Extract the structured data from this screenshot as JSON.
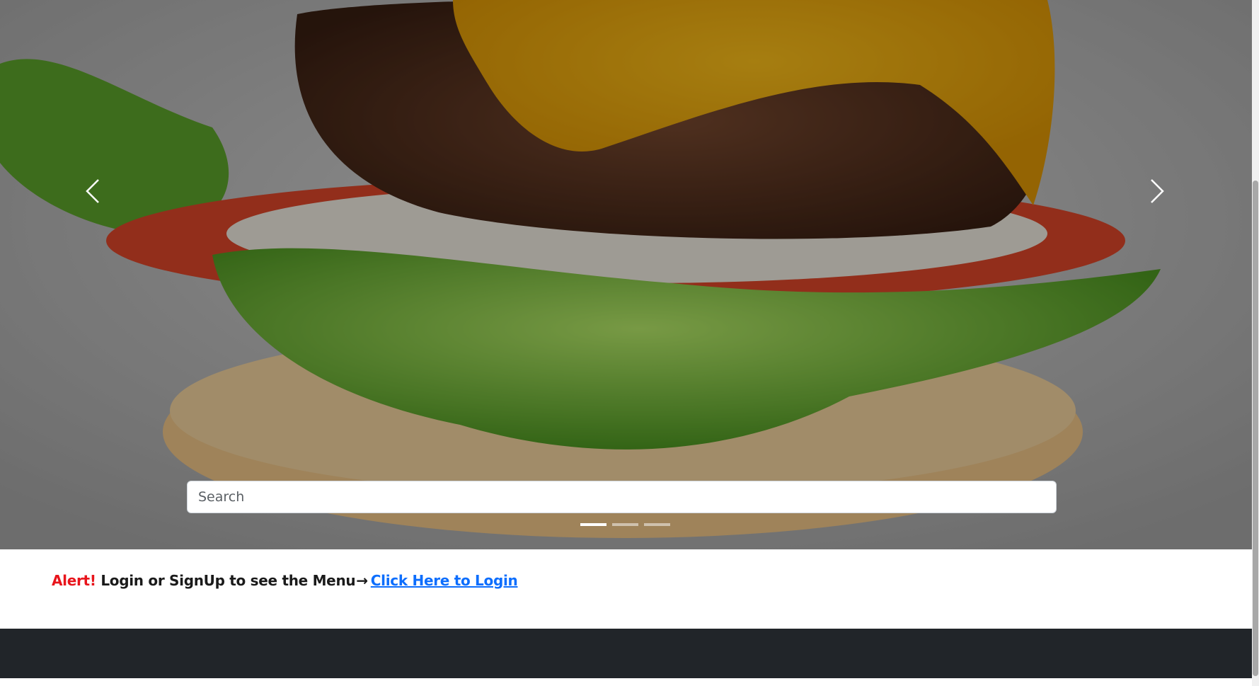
{
  "carousel": {
    "image_description_icon": "burger-photo",
    "prev_icon": "chevron-left-icon",
    "next_icon": "chevron-right-icon",
    "indicators": [
      {
        "active": true
      },
      {
        "active": false
      },
      {
        "active": false
      }
    ]
  },
  "search": {
    "placeholder": "Search",
    "value": ""
  },
  "alert": {
    "alert_word": "Alert!",
    "message": "Login or SignUp to see the Menu",
    "arrow": "→",
    "link_text": "Click Here to Login"
  },
  "colors": {
    "alert_red": "#e8141b",
    "link_blue": "#0d6efd",
    "footer_bg": "#212529"
  }
}
